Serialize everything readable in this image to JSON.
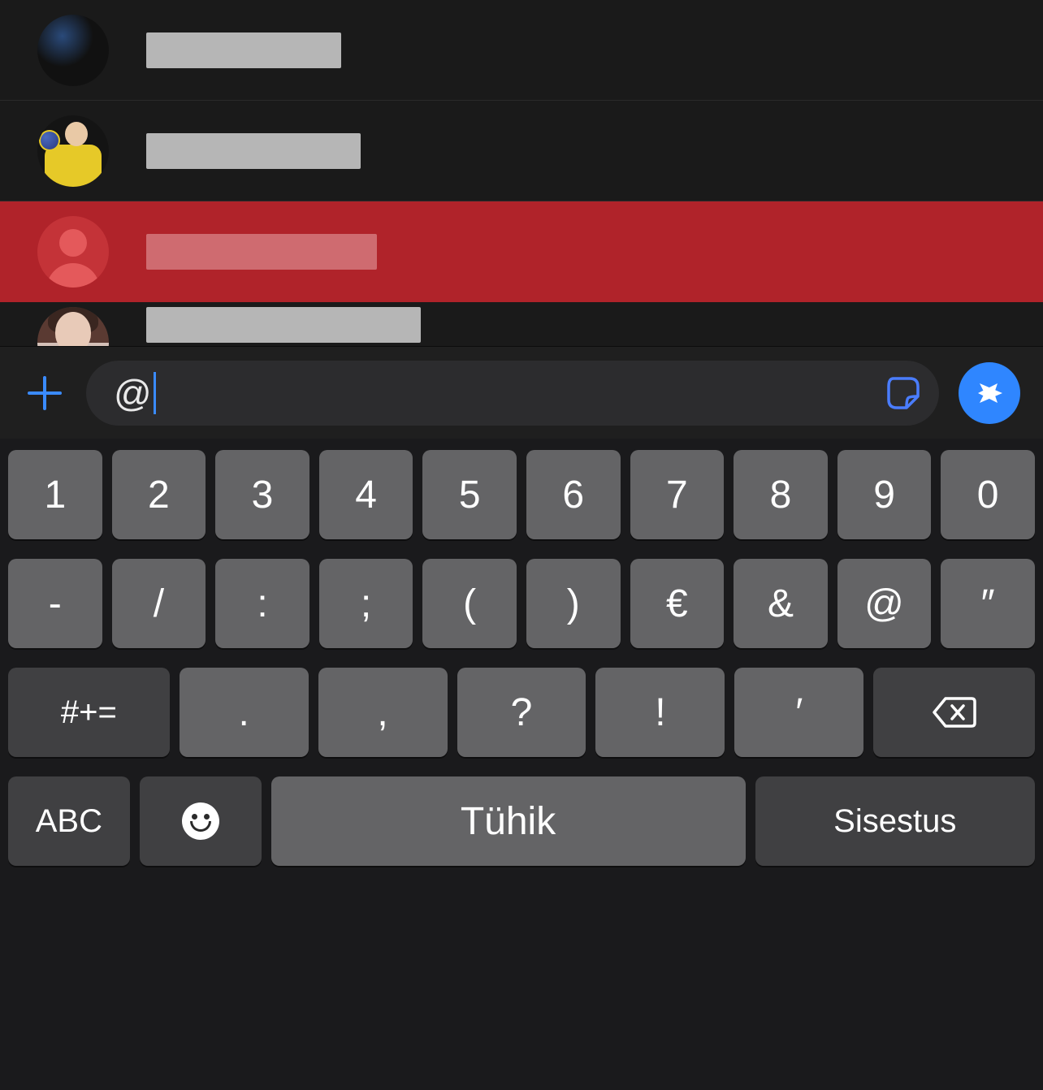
{
  "mentions": [
    {
      "redact_width": 240
    },
    {
      "redact_width": 264
    },
    {
      "redact_width": 284,
      "selected": true
    },
    {
      "redact_width": 338
    }
  ],
  "input": {
    "value": "@"
  },
  "keyboard": {
    "row1": [
      "1",
      "2",
      "3",
      "4",
      "5",
      "6",
      "7",
      "8",
      "9",
      "0"
    ],
    "row2": [
      "-",
      "/",
      ":",
      ";",
      "(",
      ")",
      "€",
      "&",
      "@",
      "″"
    ],
    "row3_symbols_label": "#+=",
    "row3_punct": [
      ".",
      ",",
      "?",
      "!",
      "′"
    ],
    "row4": {
      "abc_label": "ABC",
      "space_label": "Tühik",
      "enter_label": "Sisestus"
    }
  },
  "colors": {
    "selection": "#b0232a",
    "send": "#2f86ff",
    "accent_blue": "#3a8bff"
  }
}
